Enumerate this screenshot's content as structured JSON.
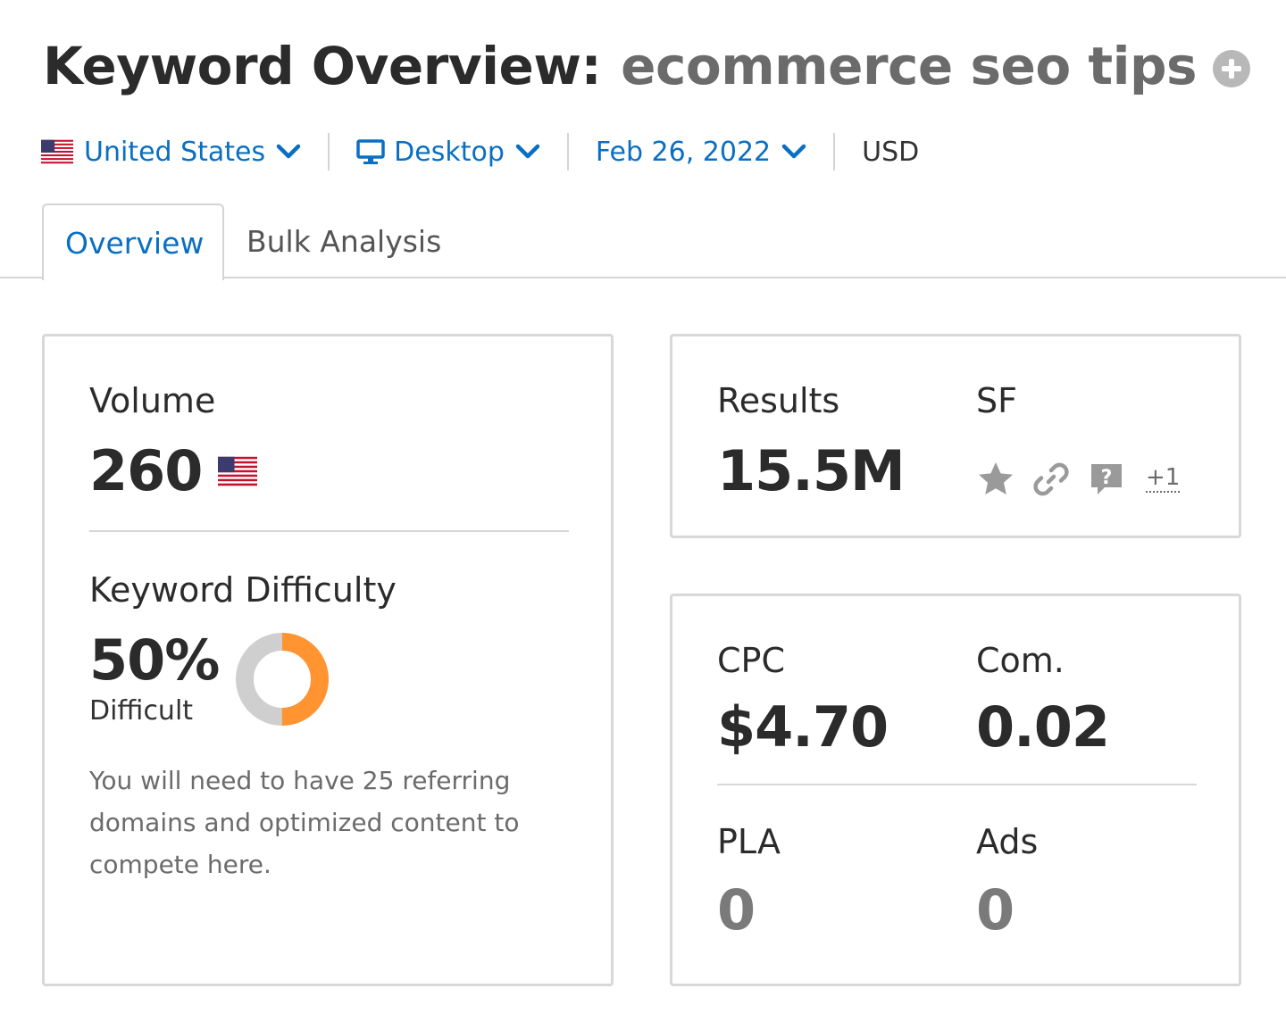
{
  "header": {
    "title": "Keyword Overview:",
    "keyword": "ecommerce seo tips"
  },
  "filters": {
    "country": "United States",
    "device": "Desktop",
    "date": "Feb 26, 2022",
    "currency": "USD"
  },
  "tabs": [
    {
      "label": "Overview",
      "active": true
    },
    {
      "label": "Bulk Analysis",
      "active": false
    }
  ],
  "volume": {
    "label": "Volume",
    "value": "260"
  },
  "keyword_difficulty": {
    "label": "Keyword Difficulty",
    "value": "50%",
    "level": "Difficult",
    "percent": 50,
    "description": "You will need to have 25 referring domains and optimized content to compete here.",
    "color_fill": "#ff9431",
    "color_track": "#cfcfcf"
  },
  "results": {
    "label": "Results",
    "value": "15.5M"
  },
  "sf": {
    "label": "SF",
    "icons": [
      "star-icon",
      "link-icon",
      "question-icon"
    ],
    "more": "+1"
  },
  "cpc": {
    "label": "CPC",
    "value": "$4.70"
  },
  "com": {
    "label": "Com.",
    "value": "0.02"
  },
  "pla": {
    "label": "PLA",
    "value": "0"
  },
  "ads": {
    "label": "Ads",
    "value": "0"
  },
  "colors": {
    "accent": "#0a6fc2",
    "text": "#2b2b2b",
    "muted": "#6b6b6b",
    "border": "#d8d8d8"
  }
}
